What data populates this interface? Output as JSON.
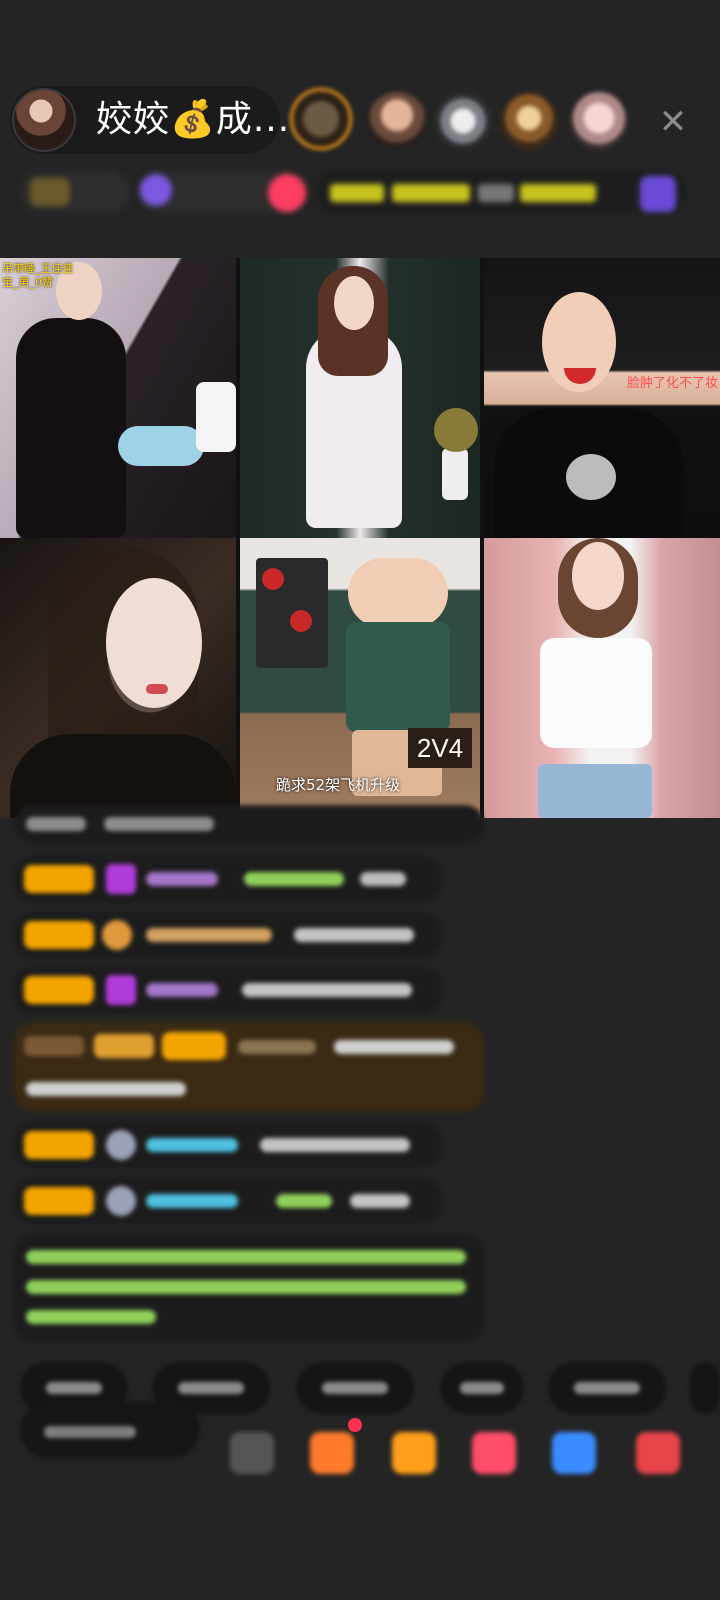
{
  "header": {
    "host_name": "姣姣💰成...",
    "close_icon": "✕"
  },
  "grid": {
    "tile1_caption": "吊带睡_王佳佳\n宝_男_0赞",
    "tile3_caption": "脸肿了化不了妆",
    "tile5_score": "2V4",
    "tile5_caption": "跪求52架飞机升级"
  },
  "colors": {
    "background": "#242424",
    "badge_orange": "#f3a400",
    "gem_purple": "#b13bd9",
    "highlight_brown": "#3a2a14",
    "system_green": "#8fcf5a"
  },
  "icons": [
    "user-avatar-icon",
    "close-icon",
    "gift-icon",
    "more-icon",
    "share-icon"
  ]
}
